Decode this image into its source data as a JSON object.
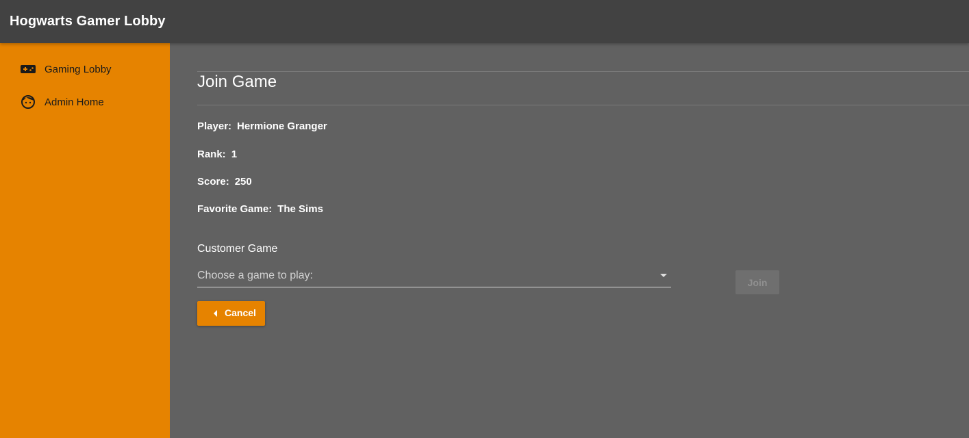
{
  "app": {
    "title": "Hogwarts Gamer Lobby"
  },
  "sidebar": {
    "items": [
      {
        "label": "Gaming Lobby",
        "icon": "gamepad-icon"
      },
      {
        "label": "Admin Home",
        "icon": "face-icon"
      }
    ]
  },
  "main": {
    "title": "Join Game",
    "player": {
      "label": "Player:",
      "value": "Hermione Granger"
    },
    "rank": {
      "label": "Rank:",
      "value": "1"
    },
    "score": {
      "label": "Score:",
      "value": "250"
    },
    "favorite_game": {
      "label": "Favorite Game:",
      "value": "The Sims"
    },
    "game_select": {
      "label": "Customer Game",
      "placeholder": "Choose a game to play:"
    },
    "join_label": "Join",
    "cancel_label": "Cancel"
  },
  "colors": {
    "accent": "#e68300",
    "topbar": "#424242",
    "content_bg": "#616161"
  }
}
